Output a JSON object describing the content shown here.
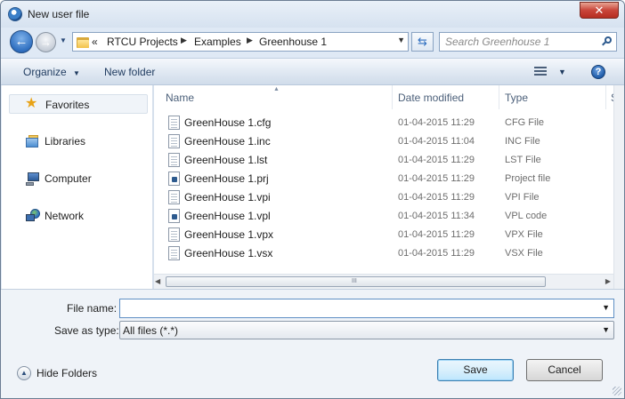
{
  "window": {
    "title": "New user file",
    "close_glyph": "✕"
  },
  "nav": {
    "back_glyph": "←",
    "forward_glyph": "→",
    "history_dropdown": "▼",
    "breadcrumb_prefix": "«",
    "breadcrumb": [
      "RTCU Projects",
      "Examples",
      "Greenhouse 1"
    ],
    "separator": "▶",
    "address_dropdown": "▼",
    "refresh_glyph": "⇆",
    "search_placeholder": "Search Greenhouse 1"
  },
  "toolbar": {
    "organize_label": "Organize",
    "organize_caret": "▼",
    "new_folder_label": "New folder",
    "view_caret": "▼",
    "help_glyph": "?"
  },
  "sidebar": {
    "items": [
      {
        "label": "Favorites",
        "icon": "star-icon"
      },
      {
        "label": "Libraries",
        "icon": "libraries-icon"
      },
      {
        "label": "Computer",
        "icon": "computer-icon"
      },
      {
        "label": "Network",
        "icon": "network-icon"
      }
    ]
  },
  "file_list": {
    "columns": [
      "Name",
      "Date modified",
      "Type",
      "Si"
    ],
    "sort_caret": "▲",
    "rows": [
      {
        "name": "GreenHouse 1.cfg",
        "date": "01-04-2015 11:29",
        "type": "CFG File",
        "icon": "document-icon"
      },
      {
        "name": "GreenHouse 1.inc",
        "date": "01-04-2015 11:04",
        "type": "INC File",
        "icon": "document-icon"
      },
      {
        "name": "GreenHouse 1.lst",
        "date": "01-04-2015 11:29",
        "type": "LST File",
        "icon": "document-icon"
      },
      {
        "name": "GreenHouse 1.prj",
        "date": "01-04-2015 11:29",
        "type": "Project file",
        "icon": "project-file-icon"
      },
      {
        "name": "GreenHouse 1.vpi",
        "date": "01-04-2015 11:29",
        "type": "VPI File",
        "icon": "document-icon"
      },
      {
        "name": "GreenHouse 1.vpl",
        "date": "01-04-2015 11:34",
        "type": "VPL code",
        "icon": "vpl-file-icon"
      },
      {
        "name": "GreenHouse 1.vpx",
        "date": "01-04-2015 11:29",
        "type": "VPX File",
        "icon": "document-icon"
      },
      {
        "name": "GreenHouse 1.vsx",
        "date": "01-04-2015 11:29",
        "type": "VSX File",
        "icon": "document-icon"
      }
    ],
    "hscroll_left": "◀",
    "hscroll_right": "▶",
    "hscroll_grip": "III"
  },
  "form": {
    "file_name_label": "File name:",
    "file_name_value": "",
    "file_name_dropdown": "▼",
    "save_as_type_label": "Save as type:",
    "save_as_type_value": "All files (*.*)",
    "save_as_type_dropdown": "▼"
  },
  "footer": {
    "hide_folders_label": "Hide Folders",
    "hide_folders_glyph": "▲",
    "save_label": "Save",
    "cancel_label": "Cancel"
  },
  "colors": {
    "accent": "#2f6fc0",
    "window_frame": "#dfe9f5",
    "close_red": "#c9463a"
  }
}
